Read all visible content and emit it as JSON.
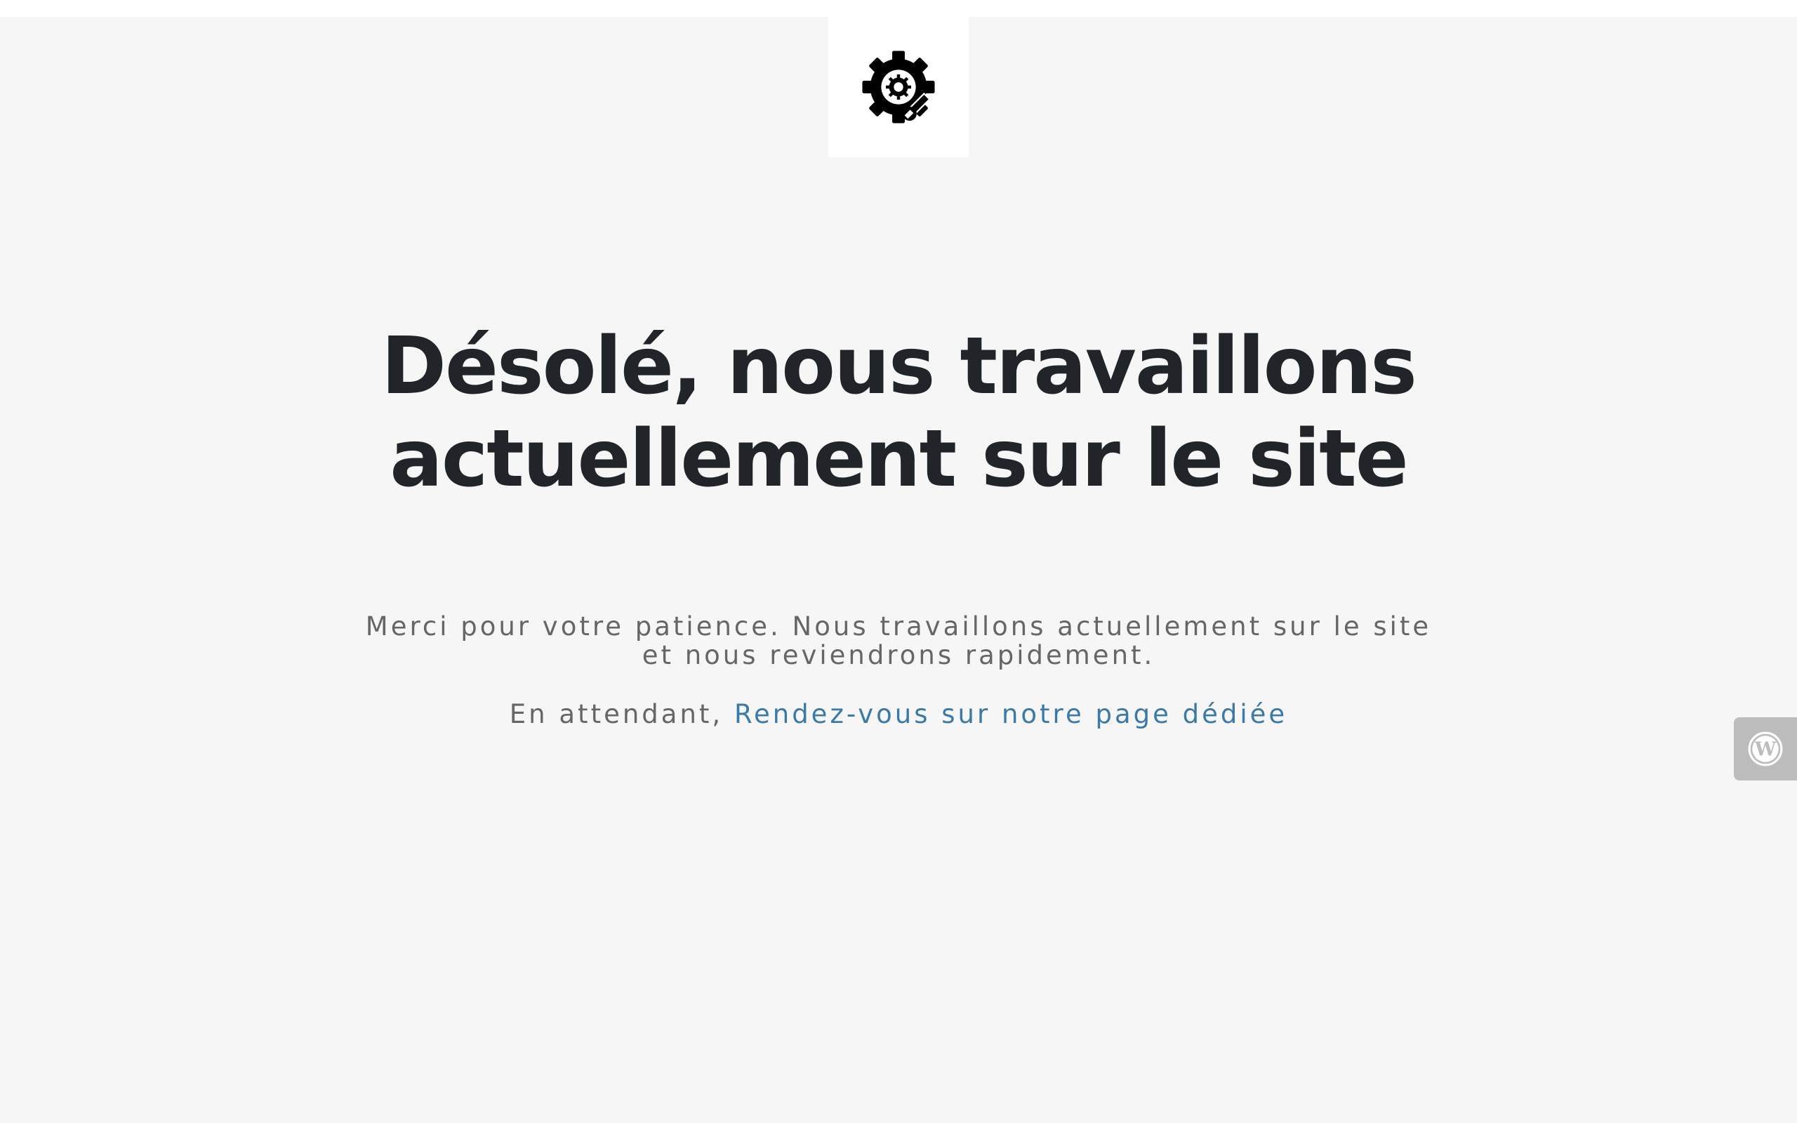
{
  "page": {
    "background_color": "#f6f6f6"
  },
  "logo": {
    "icon": "gear-wrench-icon"
  },
  "headline": {
    "line1": "Désolé, nous travaillons",
    "line2": "actuellement sur le site"
  },
  "message": {
    "text": "Merci pour votre patience. Nous travaillons actuellement sur le site et nous reviendrons rapidement."
  },
  "meantime": {
    "prefix": "En attendant, ",
    "link_text": "Rendez-vous sur notre page dédiée",
    "link_color": "#3b79a8"
  },
  "wordpress_tab": {
    "icon": "wordpress-icon"
  },
  "colors": {
    "heading": "#212529",
    "text": "#666666"
  }
}
